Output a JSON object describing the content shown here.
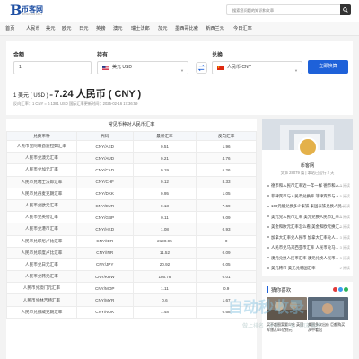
{
  "header": {
    "logo_letter": "B",
    "logo_text": "币客网",
    "logo_sub": "BINAUGRAPH",
    "search_placeholder": "搜索您问题的知识和文章"
  },
  "nav": [
    "首页",
    "人民币",
    "美元",
    "欧元",
    "日元",
    "英镑",
    "澳元",
    "瑞士法郎",
    "加元",
    "墨西哥比索",
    "新西兰元",
    "今日汇率"
  ],
  "converter": {
    "amount_label": "金额",
    "amount_value": "1",
    "from_label": "持有",
    "from_value": "美元 USD",
    "to_label": "兑换",
    "to_value": "人民币 CNY",
    "button": "立即换算",
    "result_prefix": "1 美元 ( USD ) =",
    "result_value": "7.24 人民币 ( CNY )",
    "rate_line": "反向汇率：1 CNY = 0.1381 USD    国际汇率更新时间：2025-02-16 17:36:59"
  },
  "table": {
    "title": "常见币种对人民币汇率",
    "headers": [
      "兑换币种",
      "代码",
      "最新汇率",
      "反向汇率"
    ],
    "rows": [
      [
        "人民币兑阿联酋迪拉姆汇率",
        "CNY/AED",
        "0.51",
        "1.96"
      ],
      [
        "人民币兑澳元汇率",
        "CNY/AUD",
        "0.21",
        "4.76"
      ],
      [
        "人民币兑加元汇率",
        "CNY/CAD",
        "0.19",
        "5.26"
      ],
      [
        "人民币兑瑞士法郎汇率",
        "CNY/CHF",
        "0.12",
        "8.33"
      ],
      [
        "人民币兑丹麦克朗汇率",
        "CNY/DKK",
        "0.95",
        "1.05"
      ],
      [
        "人民币兑欧元汇率",
        "CNY/EUR",
        "0.13",
        "7.69"
      ],
      [
        "人民币兑英镑汇率",
        "CNY/GBP",
        "0.11",
        "9.09"
      ],
      [
        "人民币兑港币汇率",
        "CNY/HKD",
        "1.08",
        "0.93"
      ],
      [
        "人民币兑印尼卢比汇率",
        "CNY/IDR",
        "2190.95",
        "0"
      ],
      [
        "人民币兑印度卢比汇率",
        "CNY/INR",
        "11.52",
        "0.09"
      ],
      [
        "人民币兑日元汇率",
        "CNY/JPY",
        "20.92",
        "0.05"
      ],
      [
        "人民币兑韩元汇率",
        "CNY/KRW",
        "186.78",
        "0.01"
      ],
      [
        "人民币兑澳门元汇率",
        "CNY/MOP",
        "1.11",
        "0.9"
      ],
      [
        "人民币兑林吉特汇率",
        "CNY/MYR",
        "0.6",
        "1.67"
      ],
      [
        "人民币兑挪威克朗汇率",
        "CNY/NOK",
        "1.48",
        "0.68"
      ]
    ]
  },
  "profile": {
    "name": "币客网",
    "stats": "文章 28079 篇 | 本站已运行 2 天",
    "articles": [
      {
        "title": "德币和人民币汇率近一年一样 德币和人...",
        "views": "3 阅读"
      },
      {
        "title": "菲律宾币与人民币兑换率 菲律宾币与人...",
        "views": "5 阅读"
      },
      {
        "title": "100元能兑换多少泰铢 泰国泰铢兑换人民...",
        "views": "6 阅读"
      },
      {
        "title": "美元兑人民币汇率 美元兑换人民币汇率...",
        "views": "5 阅读"
      },
      {
        "title": "美金和欧元汇率怎么看 美金和欧元换汇...",
        "views": "2 阅读"
      },
      {
        "title": "加拿大汇率兑人民币 加拿大汇率兑人...",
        "views": "3 阅读"
      },
      {
        "title": "人民币兑马来西亚币汇率 人民币兑马...",
        "views": "3 阅读"
      },
      {
        "title": "澳元兑换人民币汇率 澳元兑换人民币...",
        "views": "3 阅读"
      },
      {
        "title": "美元韩币 美元兑韩国汇率",
        "views": "2 阅读"
      }
    ]
  },
  "recommend": {
    "title": "猜你喜欢",
    "items": [
      {
        "caption": "买不起图案要少吃 英国军旅从55亿到元"
      },
      {
        "caption": "美国多次出价 巨额购买从中看出"
      }
    ]
  },
  "watermark": {
    "main": "自动秒收录",
    "sub": "做上排名 · 来访 · 一览 · 网友推荐"
  },
  "colors": {
    "accent": "#1e61d9",
    "logo": "#1e4fa3"
  }
}
